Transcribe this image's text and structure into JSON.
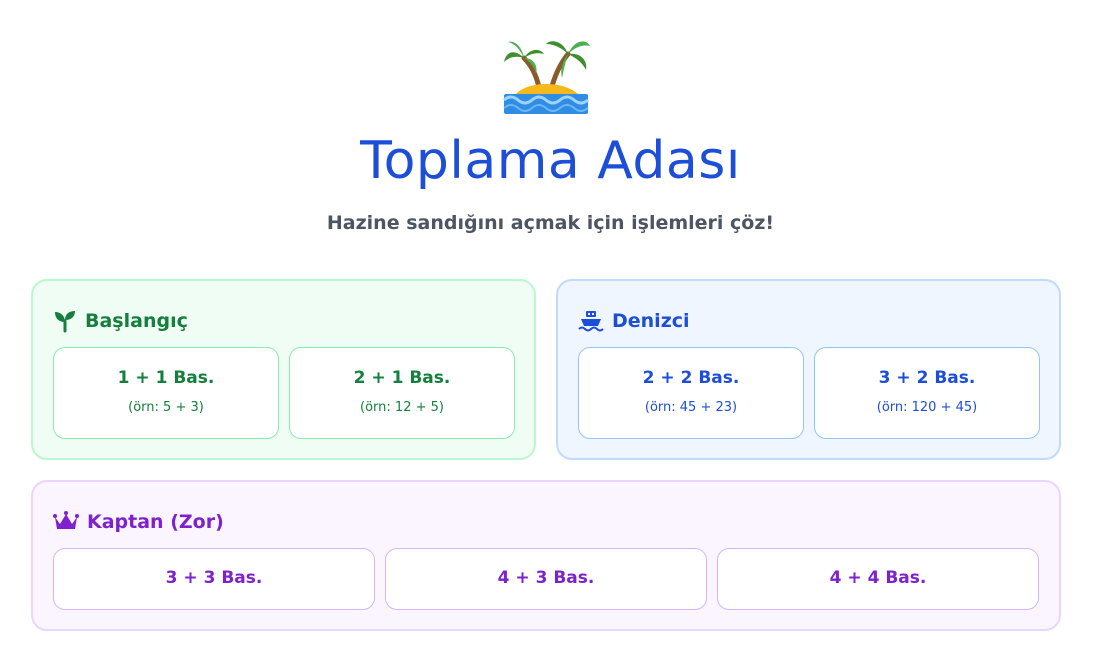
{
  "header": {
    "logo_icon": "desert-island-icon",
    "title": "Toplama Adası",
    "subtitle": "Hazine sandığını açmak için işlemleri çöz!"
  },
  "levels": [
    {
      "name": "Başlangıç",
      "icon": "seedling-icon",
      "color": "#15803d",
      "options": [
        {
          "label": "1 + 1 Bas.",
          "example": "(örn: 5 + 3)"
        },
        {
          "label": "2 + 1 Bas.",
          "example": "(örn: 12 + 5)"
        }
      ]
    },
    {
      "name": "Denizci",
      "icon": "ship-icon",
      "color": "#1d4ed8",
      "options": [
        {
          "label": "2 + 2 Bas.",
          "example": "(örn: 45 + 23)"
        },
        {
          "label": "3 + 2 Bas.",
          "example": "(örn: 120 + 45)"
        }
      ]
    },
    {
      "name": "Kaptan (Zor)",
      "icon": "crown-icon",
      "color": "#7e22ce",
      "options": [
        {
          "label": "3 + 3 Bas."
        },
        {
          "label": "4 + 3 Bas."
        },
        {
          "label": "4 + 4 Bas."
        }
      ]
    }
  ]
}
